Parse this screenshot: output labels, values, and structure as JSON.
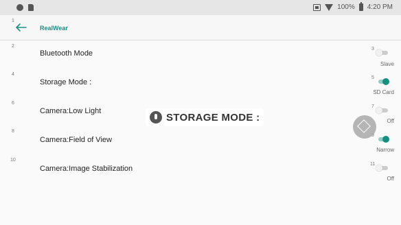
{
  "status": {
    "battery": "100%",
    "time": "4:20 PM"
  },
  "appbar": {
    "num": "1",
    "title": "RealWear"
  },
  "rows": [
    {
      "num": "2",
      "label": "Bluetooth Mode",
      "toggle_num": "3",
      "value": "Slave",
      "on": false
    },
    {
      "num": "4",
      "label": "Storage Mode :",
      "toggle_num": "5",
      "value": "SD Card",
      "on": true
    },
    {
      "num": "6",
      "label": "Camera:Low Light",
      "toggle_num": "7",
      "value": "Off",
      "on": false
    },
    {
      "num": "8",
      "label": "Camera:Field of View",
      "toggle_num": "9",
      "value": "Narrow",
      "on": true
    },
    {
      "num": "10",
      "label": "Camera:Image Stabilization",
      "toggle_num": "11",
      "value": "Off",
      "on": false
    }
  ],
  "voice_overlay": {
    "text": "STORAGE MODE :"
  },
  "colors": {
    "accent": "#168f80",
    "title": "#1f8f83"
  }
}
